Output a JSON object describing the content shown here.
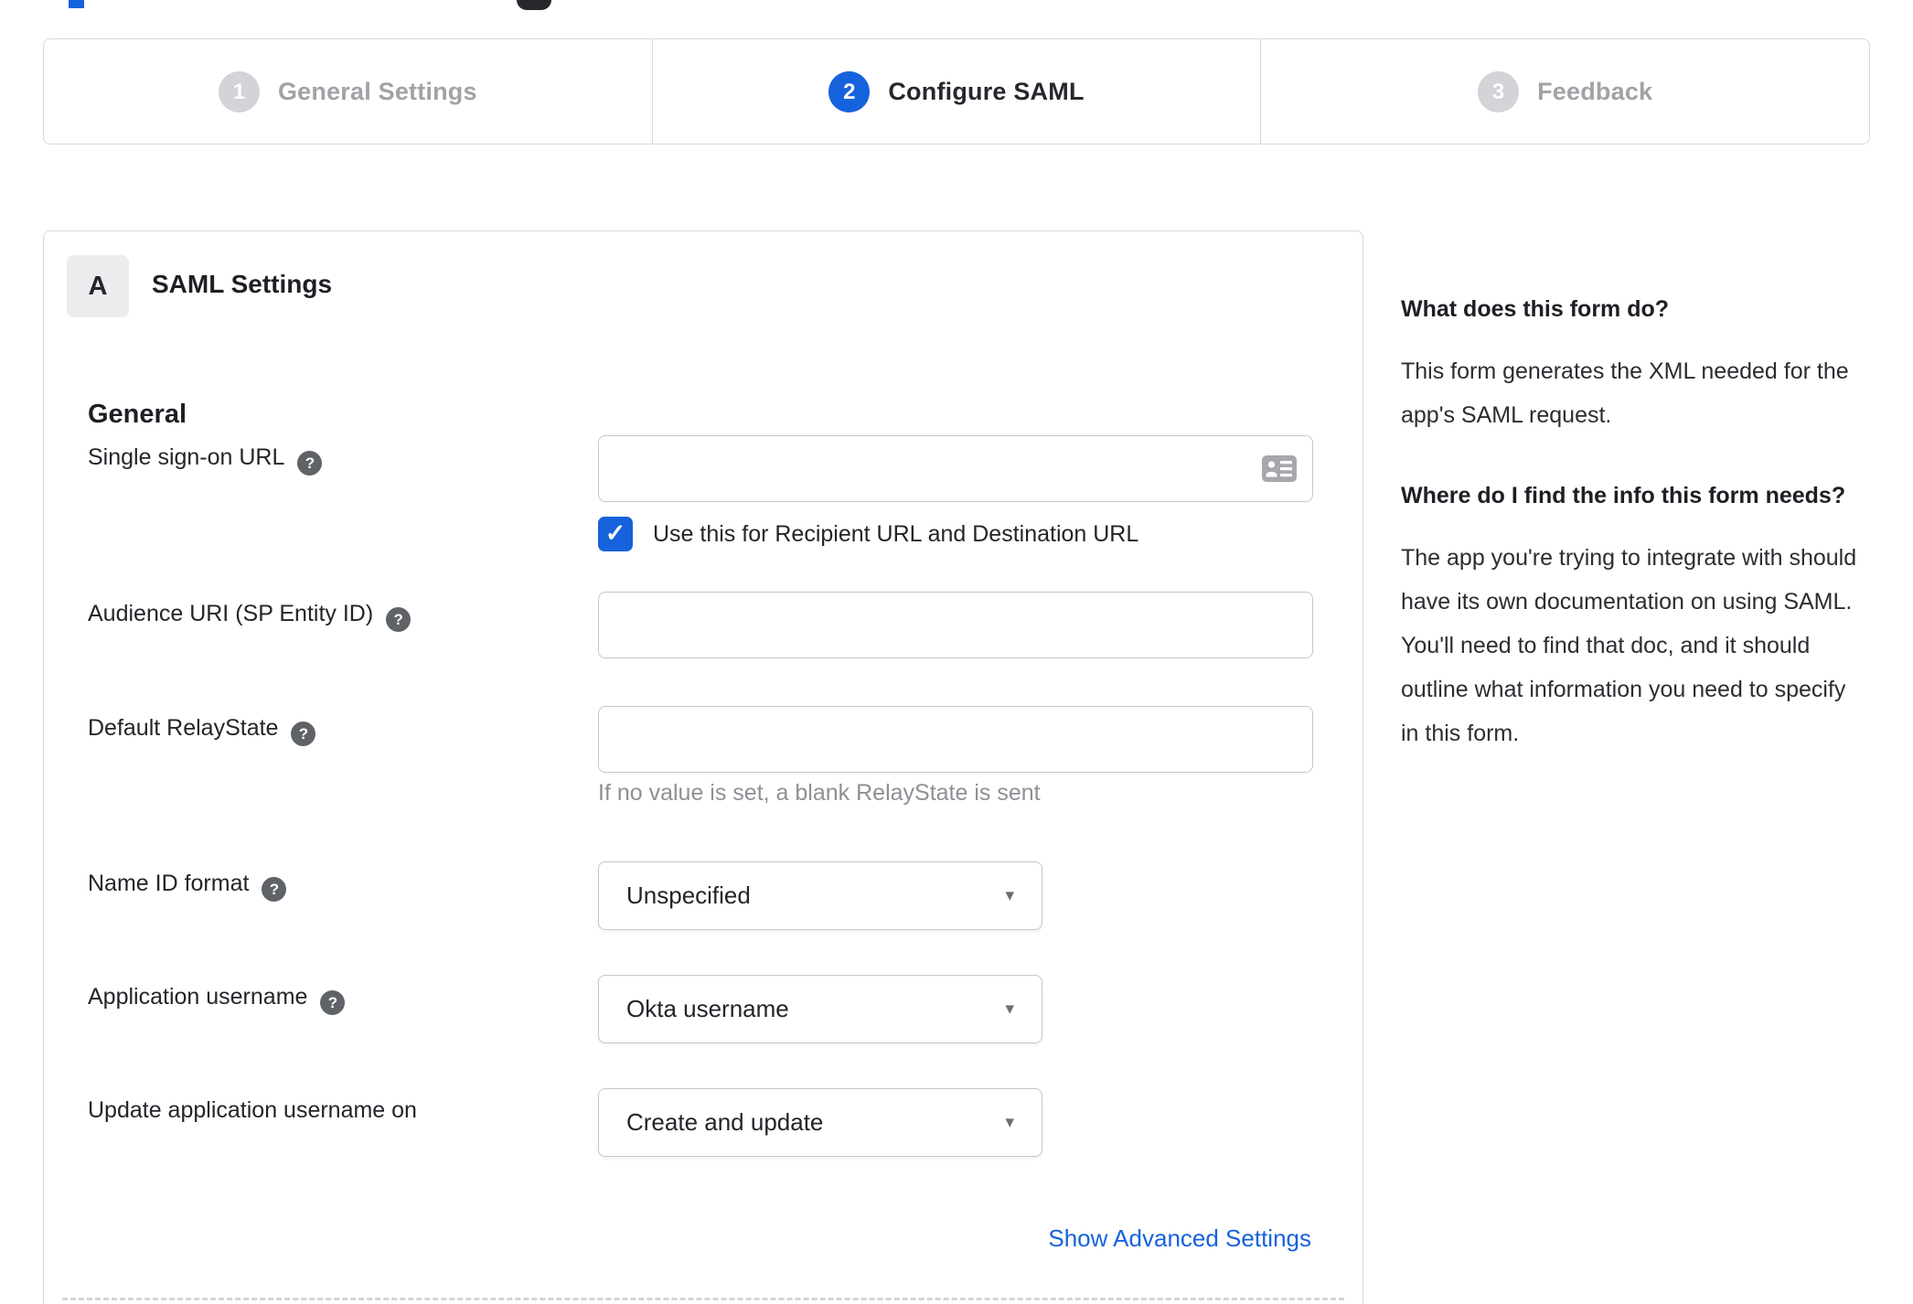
{
  "stepper": {
    "active_step": 2,
    "steps": [
      {
        "number": "1",
        "label": "General Settings"
      },
      {
        "number": "2",
        "label": "Configure SAML"
      },
      {
        "number": "3",
        "label": "Feedback"
      }
    ]
  },
  "panel": {
    "badge": "A",
    "title": "SAML Settings",
    "section": "General",
    "fields": [
      {
        "label": "Single sign-on URL",
        "type": "text",
        "value": "",
        "has_help": true
      },
      {
        "label": "Audience URI (SP Entity ID)",
        "type": "text",
        "value": "",
        "has_help": true
      },
      {
        "label": "Default RelayState",
        "type": "text",
        "value": "",
        "has_help": true,
        "helper": "If no value is set, a blank RelayState is sent"
      },
      {
        "label": "Name ID format",
        "type": "select",
        "value": "Unspecified",
        "has_help": true
      },
      {
        "label": "Application username",
        "type": "select",
        "value": "Okta username",
        "has_help": true
      },
      {
        "label": "Update application username on",
        "type": "select",
        "value": "Create and update",
        "has_help": false
      }
    ],
    "sso_checkbox": {
      "label": "Use this for Recipient URL and Destination URL",
      "checked": true
    },
    "advanced_link": "Show Advanced Settings"
  },
  "sidebar": {
    "heading1": "What does this form do?",
    "body1": "This form generates the XML needed for the app's SAML request.",
    "heading2": "Where do I find the info this form needs?",
    "body2": "The app you're trying to integrate with should have its own documentation on using SAML. You'll need to find that doc, and it should outline what information you need to specify in this form."
  },
  "icons": {
    "help_glyph": "?",
    "dropdown_caret": "▾",
    "checkbox_check": "✓",
    "sso_input_icon": "contact-card-icon"
  },
  "colors": {
    "accent_blue": "#1662dd",
    "inactive_step_gray": "#d3d4d8",
    "step_text_inactive": "#a0a2a6",
    "border_gray": "#d8d9dc",
    "text_dark": "#23252a",
    "helper_gray": "#8e9095"
  }
}
